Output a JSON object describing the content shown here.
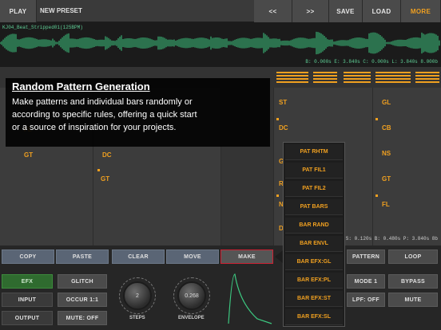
{
  "topbar": {
    "play": "PLAY",
    "preset_name": "NEW PRESET",
    "prev": "<<",
    "next": ">>",
    "save": "SAVE",
    "load": "LOAD",
    "more": "MORE"
  },
  "waveform": {
    "file_label": "KJ04_Beat_Stripped01(125BPM)",
    "markers": "B: 0.000s E: 3.840s C: 0.000s L: 3.840s 8.000b",
    "color": "#3cc880"
  },
  "grid": {
    "left_labels": [
      "GT",
      "DC",
      "GT"
    ],
    "col3": [
      "ST",
      "DC",
      "G",
      "R",
      "N",
      "D"
    ],
    "col4": [
      "GL",
      "CB",
      "NS",
      "GT",
      "FL"
    ],
    "partial_fl": "FL",
    "accent": "#f0a020"
  },
  "tooltip": {
    "title": "Random Pattern Generation",
    "body_line1": "Make patterns and individual bars randomly or",
    "body_line2": "according to specific rules, offering a quick start",
    "body_line3": "or a source of inspiration for your projects."
  },
  "menu": {
    "items": [
      "PAT RHTM",
      "PAT FIL1",
      "PAT FIL2",
      "PAT BARS",
      "BAR RAND",
      "BAR ENVL",
      "BAR EFX:GL",
      "BAR EFX:PL",
      "BAR EFX:ST",
      "BAR EFX:SL"
    ]
  },
  "info_bar": "S: 0.120s B: 0.480s P: 3.840s 8b",
  "controls": {
    "copy": "COPY",
    "paste": "PASTE",
    "clear": "CLEAR",
    "move": "MOVE",
    "make": "MAKE",
    "pattern": "PATTERN",
    "loop": "LOOP",
    "efx": "EFX",
    "input": "INPUT",
    "output": "OUTPUT",
    "glitch": "GLITCH",
    "occur": "OCCUR 1:1",
    "mute_off": "MUTE: OFF",
    "steps_value": "2",
    "steps_label": "STEPS",
    "envelope_value": "0.268",
    "envelope_label": "ENVELOPE",
    "mode": "MODE 1",
    "bypass": "BYPASS",
    "lpf": "LPF: OFF",
    "mute": "MUTE"
  }
}
